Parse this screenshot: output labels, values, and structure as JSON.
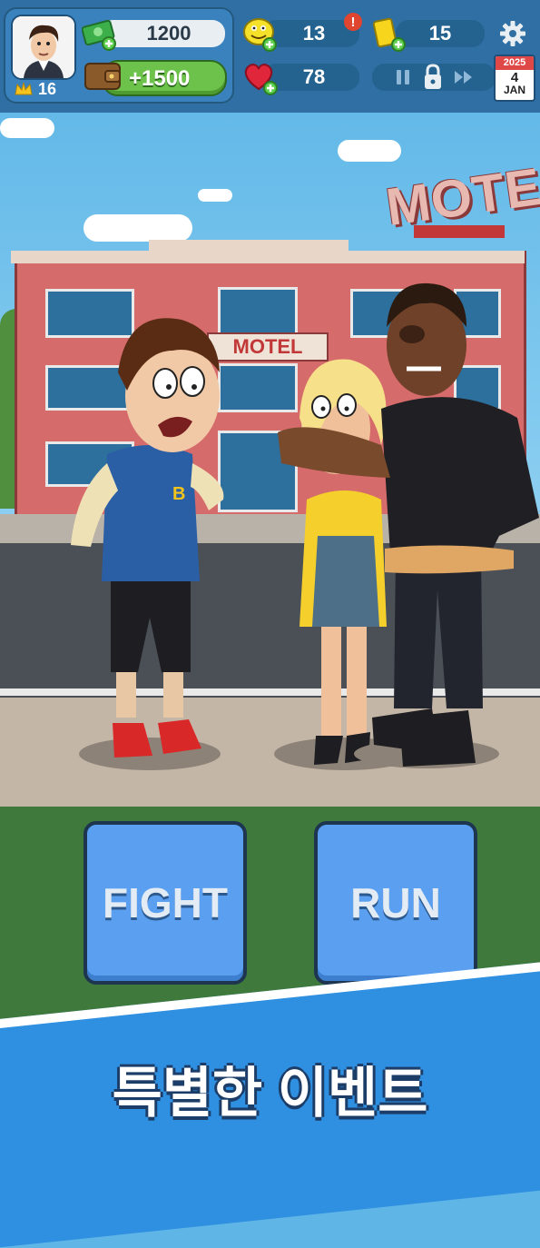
{
  "hud": {
    "level": "16",
    "cash": "1200",
    "wallet": "+1500",
    "energy": "13",
    "energy_alert": "!",
    "tickets": "15",
    "health": "78",
    "calendar": {
      "year": "2025",
      "day": "4",
      "month": "JAN"
    }
  },
  "scene": {
    "sign_roof": "MOTEL",
    "sign_wall": "MOTEL",
    "jacket_letter": "B"
  },
  "actions": {
    "fight": "FIGHT",
    "run": "RUN"
  },
  "banner": {
    "text": "특별한 이벤트"
  }
}
